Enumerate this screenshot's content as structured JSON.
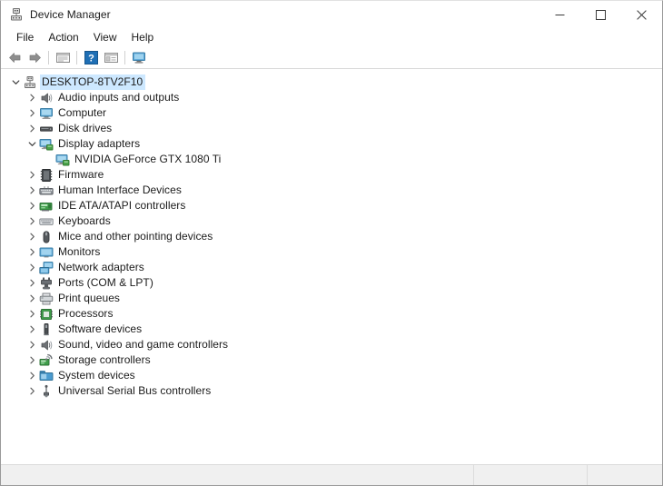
{
  "window": {
    "title": "Device Manager",
    "app_icon": "device-manager-icon",
    "controls": {
      "minimize": "minimize-icon",
      "maximize": "maximize-icon",
      "close": "close-icon"
    }
  },
  "menubar": {
    "items": [
      {
        "label": "File"
      },
      {
        "label": "Action"
      },
      {
        "label": "View"
      },
      {
        "label": "Help"
      }
    ]
  },
  "toolbar": {
    "buttons": [
      {
        "name": "back-arrow-icon",
        "type": "icon"
      },
      {
        "name": "forward-arrow-icon",
        "type": "icon"
      },
      {
        "name": "separator",
        "type": "sep"
      },
      {
        "name": "show-hide-console-tree-icon",
        "type": "icon"
      },
      {
        "name": "separator",
        "type": "sep"
      },
      {
        "name": "help-icon",
        "type": "icon"
      },
      {
        "name": "properties-icon",
        "type": "icon"
      },
      {
        "name": "separator",
        "type": "sep"
      },
      {
        "name": "scan-for-hardware-changes-icon",
        "type": "icon"
      }
    ]
  },
  "tree": {
    "root": {
      "label": "DESKTOP-8TV2F10",
      "icon": "computer-node-icon",
      "expanded": true,
      "selected": true
    },
    "items": [
      {
        "label": "Audio inputs and outputs",
        "icon": "speaker-icon",
        "expanded": false,
        "indent": 1
      },
      {
        "label": "Computer",
        "icon": "monitor-icon",
        "expanded": false,
        "indent": 1
      },
      {
        "label": "Disk drives",
        "icon": "disk-drive-icon",
        "expanded": false,
        "indent": 1
      },
      {
        "label": "Display adapters",
        "icon": "display-adapter-icon",
        "expanded": true,
        "indent": 1
      },
      {
        "label": "NVIDIA GeForce GTX 1080 Ti",
        "icon": "display-adapter-icon",
        "expanded": null,
        "indent": 2
      },
      {
        "label": "Firmware",
        "icon": "firmware-chip-icon",
        "expanded": false,
        "indent": 1
      },
      {
        "label": "Human Interface Devices",
        "icon": "hid-icon",
        "expanded": false,
        "indent": 1
      },
      {
        "label": "IDE ATA/ATAPI controllers",
        "icon": "ide-controller-icon",
        "expanded": false,
        "indent": 1
      },
      {
        "label": "Keyboards",
        "icon": "keyboard-icon",
        "expanded": false,
        "indent": 1
      },
      {
        "label": "Mice and other pointing devices",
        "icon": "mouse-icon",
        "expanded": false,
        "indent": 1
      },
      {
        "label": "Monitors",
        "icon": "monitor-screen-icon",
        "expanded": false,
        "indent": 1
      },
      {
        "label": "Network adapters",
        "icon": "network-adapter-icon",
        "expanded": false,
        "indent": 1
      },
      {
        "label": "Ports (COM & LPT)",
        "icon": "port-plug-icon",
        "expanded": false,
        "indent": 1
      },
      {
        "label": "Print queues",
        "icon": "printer-icon",
        "expanded": false,
        "indent": 1
      },
      {
        "label": "Processors",
        "icon": "processor-icon",
        "expanded": false,
        "indent": 1
      },
      {
        "label": "Software devices",
        "icon": "software-device-icon",
        "expanded": false,
        "indent": 1
      },
      {
        "label": "Sound, video and game controllers",
        "icon": "speaker-icon",
        "expanded": false,
        "indent": 1
      },
      {
        "label": "Storage controllers",
        "icon": "storage-controller-icon",
        "expanded": false,
        "indent": 1
      },
      {
        "label": "System devices",
        "icon": "system-device-icon",
        "expanded": false,
        "indent": 1
      },
      {
        "label": "Universal Serial Bus controllers",
        "icon": "usb-icon",
        "expanded": false,
        "indent": 1
      }
    ]
  },
  "statusbar": {
    "cells": [
      "",
      "",
      ""
    ]
  },
  "colors": {
    "selection": "#cde8ff",
    "text": "#1b1b1b",
    "chevron": "#5a5a5a",
    "statusbar_bg": "#f0f0f0",
    "window_border": "#9a9a9a"
  }
}
